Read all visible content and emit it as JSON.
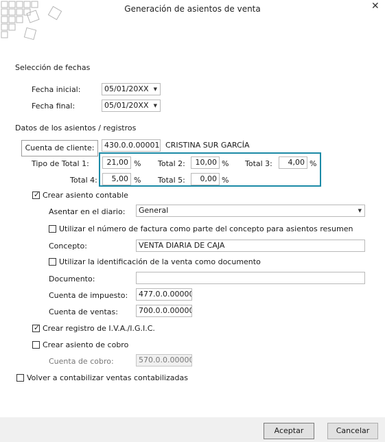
{
  "window": {
    "title": "Generación de asientos de venta"
  },
  "dates": {
    "section_title": "Selección de fechas",
    "start_label": "Fecha inicial:",
    "start_value": "05/01/20XX",
    "end_label": "Fecha final:",
    "end_value": "05/01/20XX"
  },
  "data_section": {
    "title": "Datos de los asientos / registros",
    "client_button": "Cuenta de cliente:",
    "client_account": "430.0.0.00001",
    "client_name": "CRISTINA SUR GARCÍA"
  },
  "totals": {
    "type1_label": "Tipo de Total 1:",
    "type1_value": "21,00",
    "total2_label": "Total 2:",
    "total2_value": "10,00",
    "total3_label": "Total 3:",
    "total3_value": "4,00",
    "total4_label": "Total 4:",
    "total4_value": "5,00",
    "total5_label": "Total 5:",
    "total5_value": "0,00",
    "percent": "%"
  },
  "accounting": {
    "create_entry_label": "Crear asiento contable",
    "create_entry_checked": true,
    "journal_label": "Asentar en el diario:",
    "journal_value": "General",
    "use_invoice_label": "Utilizar el número de factura como parte del concepto para asientos resumen",
    "use_invoice_checked": false,
    "concept_label": "Concepto:",
    "concept_value": "VENTA DIARIA DE CAJA",
    "use_sale_id_label": "Utilizar la identificación de la venta como documento",
    "use_sale_id_checked": false,
    "document_label": "Documento:",
    "document_value": "",
    "tax_account_label": "Cuenta de impuesto:",
    "tax_account_value": "477.0.0.00000",
    "sales_account_label": "Cuenta de ventas:",
    "sales_account_value": "700.0.0.00000"
  },
  "vat": {
    "label": "Crear registro de I.V.A./I.G.I.C.",
    "checked": true
  },
  "collection": {
    "label": "Crear asiento de cobro",
    "checked": false,
    "account_label": "Cuenta de cobro:",
    "account_value": "570.0.0.00000"
  },
  "recount": {
    "label": "Volver a contabilizar ventas contabilizadas",
    "checked": false
  },
  "buttons": {
    "accept": "Aceptar",
    "cancel": "Cancelar"
  },
  "icons": {
    "close": "close-icon",
    "logo": "squares-logo",
    "dropdown": "chevron-down-icon",
    "check": "checkmark-icon"
  }
}
